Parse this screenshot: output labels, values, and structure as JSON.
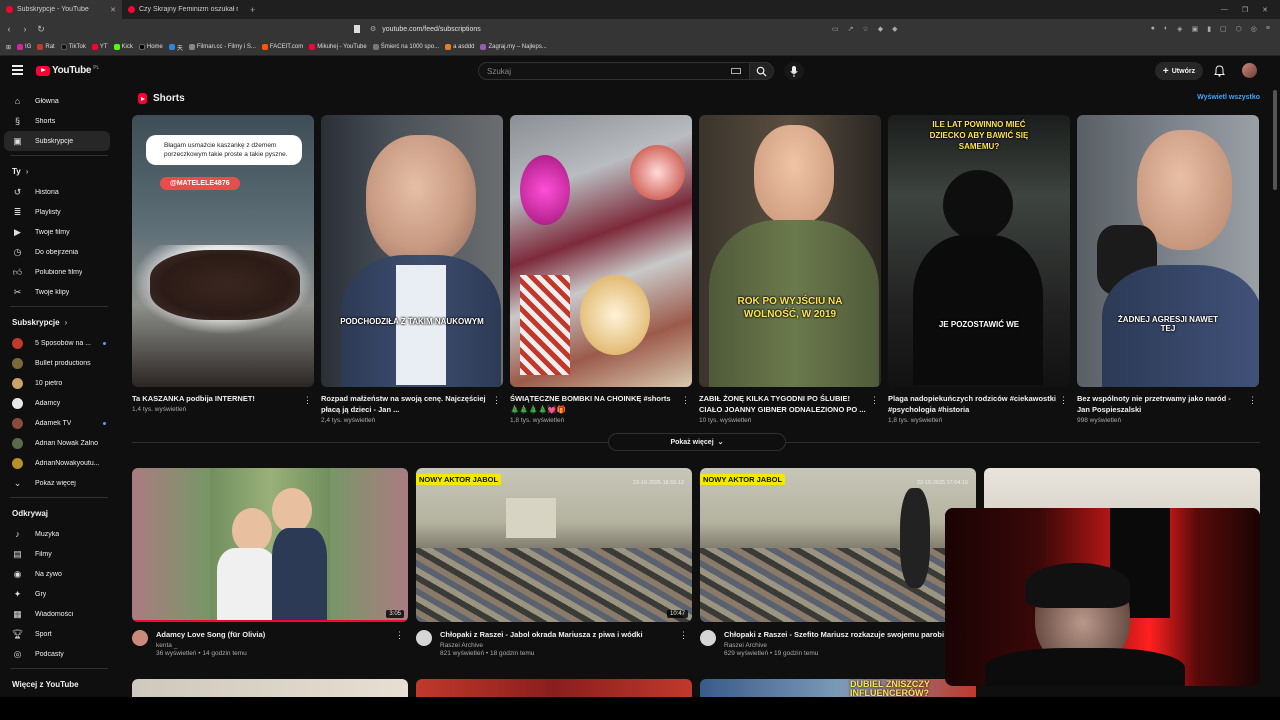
{
  "browser": {
    "tabs": [
      {
        "title": "Subskrypcje - YouTube",
        "active": true
      },
      {
        "title": "Czy Skrajny Feminizm oszukał młodzi...",
        "active": false
      }
    ],
    "url": "youtube.com/feed/subscriptions",
    "bookmarks": [
      "IG",
      "Rat",
      "TikTok",
      "YT",
      "Kick",
      "Home",
      "天",
      "Filman.cc - Filmy i S...",
      "FACEIT.com",
      "Mikuhej - YouTube",
      "Śmierć na 1000 spo...",
      "a asddd",
      "Zagraj.my – Najleps..."
    ]
  },
  "header": {
    "logo_text": "YouTube",
    "country_code": "PL",
    "search_placeholder": "Szukaj",
    "create_label": "Utwórz"
  },
  "sidebar": {
    "main": [
      {
        "label": "Główna",
        "icon": "home-icon"
      },
      {
        "label": "Shorts",
        "icon": "shorts-icon"
      },
      {
        "label": "Subskrypcje",
        "icon": "subscriptions-icon",
        "active": true
      }
    ],
    "you_title": "Ty",
    "you": [
      {
        "label": "Historia",
        "icon": "history-icon"
      },
      {
        "label": "Playlisty",
        "icon": "playlist-icon"
      },
      {
        "label": "Twoje filmy",
        "icon": "your-videos-icon"
      },
      {
        "label": "Do obejrzenia",
        "icon": "watch-later-icon"
      },
      {
        "label": "Polubione filmy",
        "icon": "like-icon"
      },
      {
        "label": "Twoje klipy",
        "icon": "clip-icon"
      }
    ],
    "subs_title": "Subskrypcje",
    "subs": [
      {
        "label": "5 Sposobów na ...",
        "color": "#c0392b",
        "live": true
      },
      {
        "label": "Bullet productions",
        "color": "#7a6a3a"
      },
      {
        "label": "10 pietro",
        "color": "#c9a36a"
      },
      {
        "label": "Adamcy",
        "color": "#e8e8e8"
      },
      {
        "label": "Adamek TV",
        "color": "#8a4b3b",
        "live": true
      },
      {
        "label": "Adrian Nowak Zalno",
        "color": "#5a6b4a"
      },
      {
        "label": "AdrianNowakyoutu...",
        "color": "#b8902a"
      }
    ],
    "show_more": "Pokaż więcej",
    "explore_title": "Odkrywaj",
    "explore": [
      {
        "label": "Muzyka",
        "icon": "music-icon"
      },
      {
        "label": "Filmy",
        "icon": "film-icon"
      },
      {
        "label": "Na żywo",
        "icon": "live-icon"
      },
      {
        "label": "Gry",
        "icon": "gaming-icon"
      },
      {
        "label": "Wiadomości",
        "icon": "news-icon"
      },
      {
        "label": "Sport",
        "icon": "trophy-icon"
      },
      {
        "label": "Podcasty",
        "icon": "podcast-icon"
      }
    ],
    "more_title": "Więcej z YouTube"
  },
  "shorts": {
    "title": "Shorts",
    "see_all": "Wyświetl wszystko",
    "items": [
      {
        "title": "Ta KASZANKA podbija INTERNET!",
        "views": "1,4 tys. wyświetleń",
        "bubble": "Błagam usmażcie kaszankę z dżemem porzeczkowym takie proste a takie pyszne.",
        "tag": "@MATELELE4876"
      },
      {
        "title": "Rozpad małżeństw na swoją cenę. Najczęściej płacą ją dzieci - Jan ...",
        "views": "2,4 tys. wyświetleń",
        "overlay": "PODCHODZIŁA Z TAKIM NAUKOWYM"
      },
      {
        "title": "ŚWIĄTECZNE BOMBKI NA CHOINKĘ #shorts 🎄🎄🎄🎄💓🎁",
        "views": "1,8 tys. wyświetleń"
      },
      {
        "title": "ZABIŁ ŻONĘ KILKA TYGODNI PO ŚLUBIE! CIAŁO JOANNY GIBNER ODNALEZIONO PO ...",
        "views": "10 tys. wyświetleń",
        "overlay": "ROK PO WYJŚCIU NA WOLNOŚĆ, W 2019"
      },
      {
        "title": "Plaga nadopiekuńczych rodziców #ciekawostki #psychologia #historia",
        "views": "1,8 tys. wyświetleń",
        "overlay_top": "ILE LAT POWINNO MIEĆ DZIECKO ABY BAWIĆ SIĘ SAMEMU?",
        "overlay": "JE POZOSTAWIĆ WE"
      },
      {
        "title": "Bez wspólnoty nie przetrwamy jako naród - Jan Pospieszalski",
        "views": "998 wyświetleń",
        "overlay": "ŻADNEJ AGRESJI NAWET TEJ"
      }
    ],
    "show_more": "Pokaż więcej"
  },
  "videos": [
    {
      "title": "Adamcy Love Song (für Olivia)",
      "channel": "kenta _",
      "meta": "36 wyświetleń • 14 godzin temu",
      "duration": "3:05",
      "progress": 1.0
    },
    {
      "title": "Chłopaki z Raszei - Jabol okrada Mariusza z piwa i wódki",
      "channel": "Raszei Archive",
      "meta": "821 wyświetleń • 18 godzin temu",
      "duration": "10:47",
      "label": "NOWY AKTOR JABOL",
      "camtime": "23-10-2025 18:55:12"
    },
    {
      "title": "Chłopaki z Raszei - Szefito Mariusz rozkazuje swojemu parobi",
      "channel": "Raszei Archive",
      "meta": "629 wyświetleń • 19 godzin temu",
      "label": "NOWY AKTOR JABOL",
      "camtime": "23-10-2025 17:04:19"
    }
  ],
  "row3_overlay": "DUBIEL ZNISZCZY INFLUENCERÓW?"
}
